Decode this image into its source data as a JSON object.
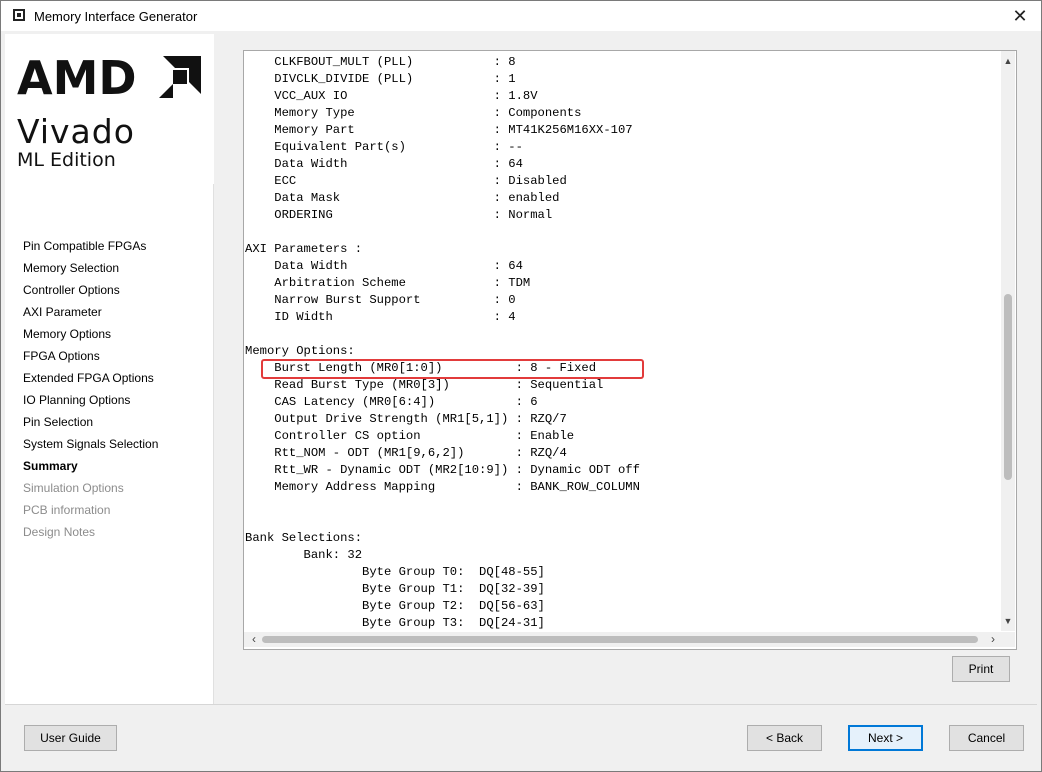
{
  "window": {
    "title": "Memory Interface Generator"
  },
  "brand": {
    "company": "AMD",
    "product": "Vivado",
    "edition": "ML Edition"
  },
  "nav": {
    "items": [
      {
        "label": "Pin Compatible FPGAs",
        "state": "normal"
      },
      {
        "label": "Memory Selection",
        "state": "normal"
      },
      {
        "label": "Controller Options",
        "state": "normal"
      },
      {
        "label": "AXI Parameter",
        "state": "normal"
      },
      {
        "label": "Memory Options",
        "state": "normal"
      },
      {
        "label": "FPGA Options",
        "state": "normal"
      },
      {
        "label": "Extended FPGA Options",
        "state": "normal"
      },
      {
        "label": "IO Planning Options",
        "state": "normal"
      },
      {
        "label": "Pin Selection",
        "state": "normal"
      },
      {
        "label": "System Signals Selection",
        "state": "normal"
      },
      {
        "label": "Summary",
        "state": "active"
      },
      {
        "label": "Simulation Options",
        "state": "disabled"
      },
      {
        "label": "PCB information",
        "state": "disabled"
      },
      {
        "label": "Design Notes",
        "state": "disabled"
      }
    ]
  },
  "summary": {
    "lines": [
      "    CLKFBOUT_MULT (PLL)           : 8",
      "    DIVCLK_DIVIDE (PLL)           : 1",
      "    VCC_AUX IO                    : 1.8V",
      "    Memory Type                   : Components",
      "    Memory Part                   : MT41K256M16XX-107",
      "    Equivalent Part(s)            : --",
      "    Data Width                    : 64",
      "    ECC                           : Disabled",
      "    Data Mask                     : enabled",
      "    ORDERING                      : Normal",
      "",
      "AXI Parameters :",
      "    Data Width                    : 64",
      "    Arbitration Scheme            : TDM",
      "    Narrow Burst Support          : 0",
      "    ID Width                      : 4",
      "",
      "Memory Options:",
      "    Burst Length (MR0[1:0])          : 8 - Fixed",
      "    Read Burst Type (MR0[3])         : Sequential",
      "    CAS Latency (MR0[6:4])           : 6",
      "    Output Drive Strength (MR1[5,1]) : RZQ/7",
      "    Controller CS option             : Enable",
      "    Rtt_NOM - ODT (MR1[9,6,2])       : RZQ/4",
      "    Rtt_WR - Dynamic ODT (MR2[10:9]) : Dynamic ODT off",
      "    Memory Address Mapping           : BANK_ROW_COLUMN",
      "",
      "",
      "Bank Selections:",
      "        Bank: 32",
      "                Byte Group T0:  DQ[48-55]",
      "                Byte Group T1:  DQ[32-39]",
      "                Byte Group T2:  DQ[56-63]",
      "                Byte Group T3:  DQ[24-31]"
    ]
  },
  "buttons": {
    "print": "Print",
    "user_guide": "User Guide",
    "back": "< Back",
    "next": "Next >",
    "cancel": "Cancel"
  },
  "colors": {
    "highlight": "#e23b3b",
    "primary_border": "#0078d7"
  },
  "icons": {
    "close": "close-icon",
    "app": "app-icon"
  }
}
